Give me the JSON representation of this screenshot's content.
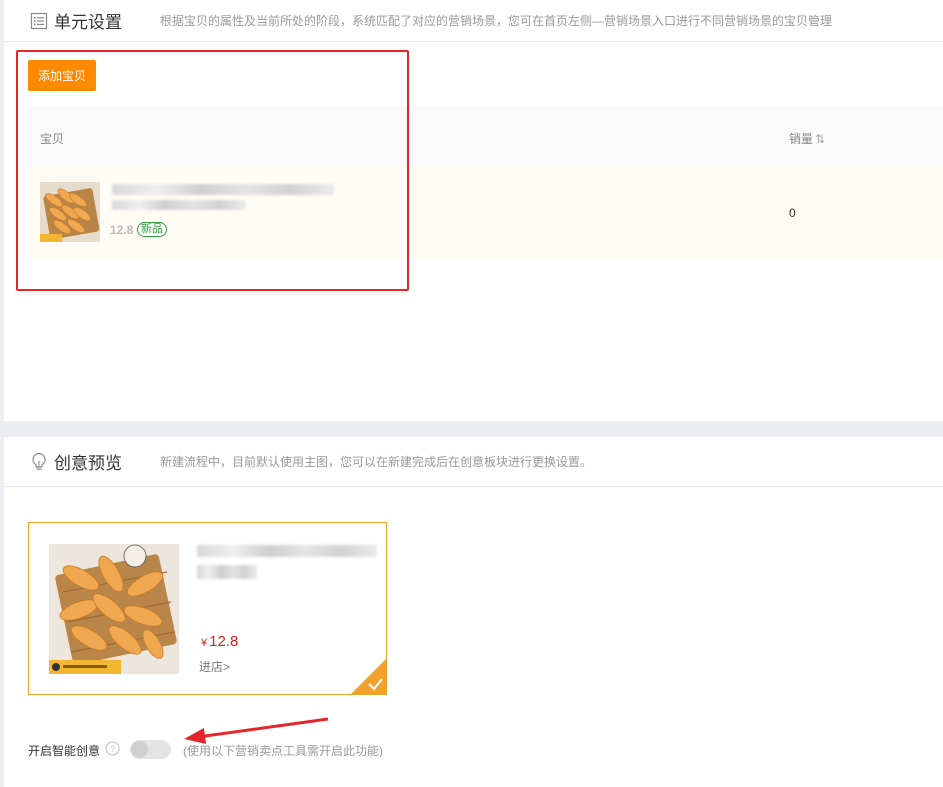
{
  "unit_section": {
    "title": "单元设置",
    "description": "根据宝贝的属性及当前所处的阶段，系统匹配了对应的营销场景，您可在首页左侧—营销场景入口进行不同营销场景的宝贝管理",
    "add_button": "添加宝贝",
    "columns": {
      "product": "宝贝",
      "sales": "销量",
      "sort_icon": "⇅"
    },
    "rows": [
      {
        "price": "12.8",
        "badge": "新品",
        "sales": "0"
      }
    ]
  },
  "creative_section": {
    "title": "创意预览",
    "description": "新建流程中，目前默认使用主图，您可以在新建完成后在创意板块进行更换设置。",
    "card": {
      "currency": "¥",
      "price": "12.8",
      "link": "进店>"
    },
    "smart_creative": {
      "label": "开启智能创意",
      "hint": "(使用以下营销卖点工具需开启此功能)",
      "enabled": false
    }
  },
  "colors": {
    "accent": "#ff8a00",
    "highlight_box": "#e5252a",
    "price": "#e02020",
    "badge": "#2e9d3d",
    "card_border": "#f0a22a"
  },
  "icons": [
    "list-icon",
    "bulb-icon",
    "help-icon",
    "check-icon",
    "arrow-annotation"
  ]
}
